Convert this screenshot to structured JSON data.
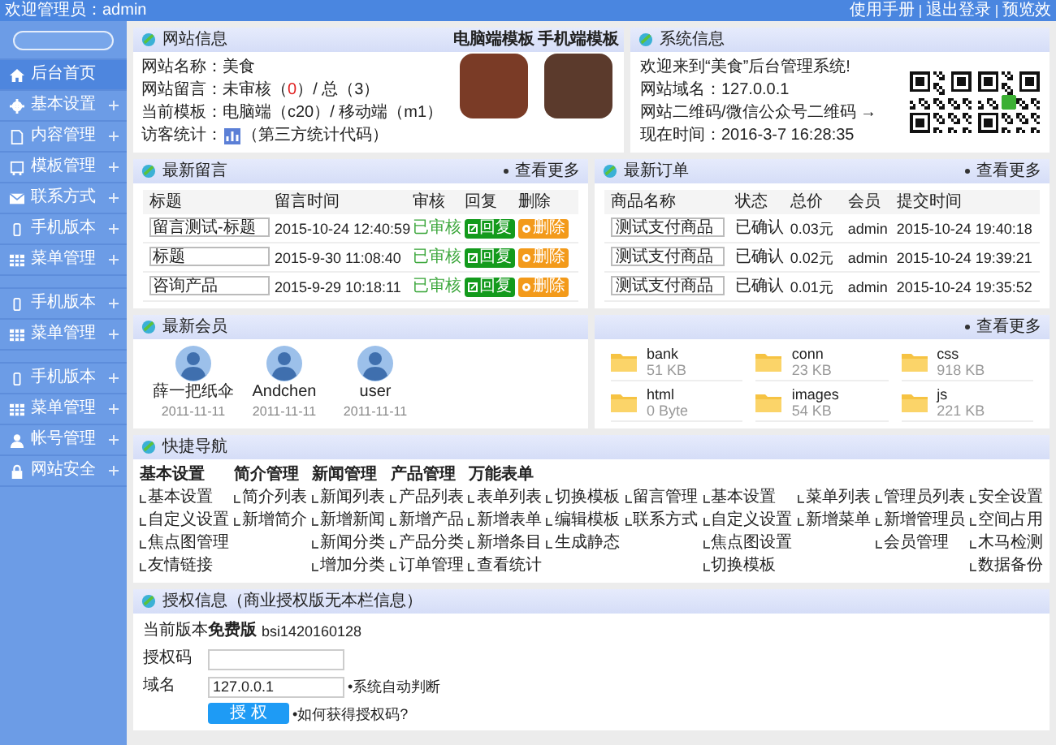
{
  "top_bar": {
    "greeting": "欢迎管理员：admin",
    "links": [
      "使用手册",
      "退出登录",
      "预览效"
    ]
  },
  "sidebar": {
    "groups": [
      {
        "items": [
          {
            "label": "后台首页",
            "selected": true
          },
          {
            "label": "基本设置",
            "selected": false
          },
          {
            "label": "内容管理",
            "selected": false
          },
          {
            "label": "模板管理",
            "selected": false
          },
          {
            "label": "联系方式",
            "selected": false
          },
          {
            "label": "手机版本",
            "selected": false
          },
          {
            "label": "菜单管理",
            "selected": false
          }
        ]
      },
      {
        "items": [
          {
            "label": "手机版本",
            "selected": false
          },
          {
            "label": "菜单管理",
            "selected": false
          }
        ]
      },
      {
        "items": [
          {
            "label": "手机版本",
            "selected": false
          },
          {
            "label": "菜单管理",
            "selected": false
          },
          {
            "label": "帐号管理",
            "selected": false
          },
          {
            "label": "网站安全",
            "selected": false
          }
        ]
      }
    ]
  },
  "site_info": {
    "title": "网站信息",
    "lines": [
      {
        "kind": "text",
        "text": "网站名称：美食"
      },
      {
        "kind": "segments",
        "segments": [
          {
            "text": "网站留言：未审核（",
            "highlight": false
          },
          {
            "text": "0",
            "highlight": true
          },
          {
            "text": "）/ 总（3）",
            "highlight": false
          }
        ]
      },
      {
        "kind": "text",
        "text": "当前模板：电脑端（c20）/ 移动端（m1）"
      },
      {
        "kind": "stats",
        "label": "访客统计：",
        "after": "（第三方统计代码）"
      }
    ],
    "templates": [
      {
        "label": "电脑端模板"
      },
      {
        "label": "手机端模板"
      }
    ]
  },
  "system_info": {
    "title": "系统信息",
    "lines": [
      "欢迎来到“美食”后台管理系统!",
      "网站域名：127.0.0.1",
      "网站二维码/微信公众号二维码 →",
      "现在时间：2016-3-7 16:28:35"
    ]
  },
  "messages": {
    "title": "最新留言",
    "more": "查看更多",
    "columns": [
      "标题",
      "留言时间",
      "审核",
      "回复",
      "删除"
    ],
    "rows": [
      {
        "title": "留言测试-标题",
        "time": "2015-10-24 12:40:59",
        "status": "已审核",
        "reply": "回复",
        "delete": "删除"
      },
      {
        "title": "标题",
        "time": "2015-9-30 11:08:40",
        "status": "已审核",
        "reply": "回复",
        "delete": "删除"
      },
      {
        "title": "咨询产品",
        "time": "2015-9-29 10:18:11",
        "status": "已审核",
        "reply": "回复",
        "delete": "删除"
      }
    ]
  },
  "orders": {
    "title": "最新订单",
    "more": "查看更多",
    "columns": [
      "商品名称",
      "状态",
      "总价",
      "会员",
      "提交时间"
    ],
    "rows": [
      {
        "product": "测试支付商品",
        "status": "已确认",
        "total": "0.03元",
        "member": "admin",
        "time": "2015-10-24 19:40:18"
      },
      {
        "product": "测试支付商品",
        "status": "已确认",
        "total": "0.02元",
        "member": "admin",
        "time": "2015-10-24 19:39:21"
      },
      {
        "product": "测试支付商品",
        "status": "已确认",
        "total": "0.01元",
        "member": "admin",
        "time": "2015-10-24 19:35:52"
      }
    ]
  },
  "members": {
    "title": "最新会员",
    "items": [
      {
        "name": "薛一把纸伞",
        "date": "2011-11-11"
      },
      {
        "name": "Andchen",
        "date": "2011-11-11"
      },
      {
        "name": "user",
        "date": "2011-11-11"
      }
    ]
  },
  "files": {
    "more": "查看更多",
    "items": [
      {
        "name": "bank",
        "size": "51 KB"
      },
      {
        "name": "conn",
        "size": "23 KB"
      },
      {
        "name": "css",
        "size": "918 KB"
      },
      {
        "name": "html",
        "size": "0 Byte"
      },
      {
        "name": "images",
        "size": "54 KB"
      },
      {
        "name": "js",
        "size": "221 KB"
      }
    ]
  },
  "quick_nav": {
    "title": "快捷导航",
    "columns": [
      {
        "heading": "基本设置",
        "items": [
          "基本设置",
          "自定义设置",
          "焦点图管理",
          "友情链接"
        ]
      },
      {
        "heading": "简介管理",
        "items": [
          "简介列表",
          "新增简介"
        ]
      },
      {
        "heading": "新闻管理",
        "items": [
          "新闻列表",
          "新增新闻",
          "新闻分类",
          "增加分类"
        ]
      },
      {
        "heading": "产品管理",
        "items": [
          "产品列表",
          "新增产品",
          "产品分类",
          "订单管理"
        ]
      },
      {
        "heading": "万能表单",
        "items": [
          "表单列表",
          "新增表单",
          "新增条目",
          "查看统计"
        ]
      },
      {
        "items": [
          "切换模板",
          "编辑模板",
          "生成静态"
        ]
      },
      {
        "items": [
          "留言管理",
          "联系方式"
        ]
      },
      {
        "items": [
          "基本设置",
          "自定义设置",
          "焦点图设置",
          "切换模板"
        ]
      },
      {
        "items": [
          "菜单列表",
          "新增菜单"
        ]
      },
      {
        "items": [
          "管理员列表",
          "新增管理员",
          "会员管理"
        ]
      },
      {
        "items": [
          "安全设置",
          "空间占用",
          "木马检测",
          "数据备份"
        ]
      }
    ]
  },
  "license": {
    "title": "授权信息（商业授权版无本栏信息）",
    "rows": [
      {
        "kind": "text",
        "label": "当前版本",
        "value": "免费版",
        "code": "bsi1420160128"
      },
      {
        "kind": "input",
        "label": "授权码"
      },
      {
        "kind": "input",
        "label": "域名",
        "value": "127.0.0.1",
        "note": "•系统自动判断"
      }
    ],
    "button": "授 权",
    "help": "•如何获得授权码?"
  }
}
